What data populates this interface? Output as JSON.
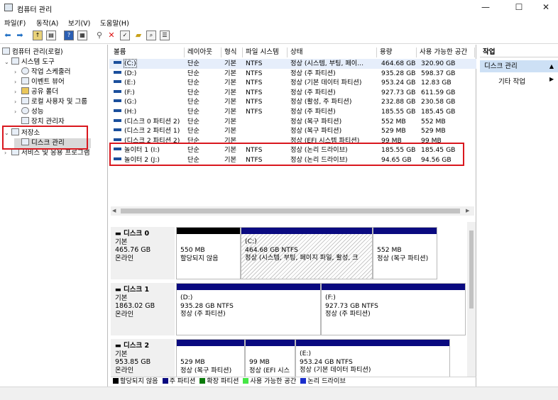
{
  "window": {
    "title": "컴퓨터 관리",
    "minimize": "—",
    "maximize": "☐",
    "close": "✕"
  },
  "menu": [
    "파일(F)",
    "동작(A)",
    "보기(V)",
    "도움말(H)"
  ],
  "tree": {
    "root": "컴퓨터 관리(로컬)",
    "system_tools": "시스템 도구",
    "task_scheduler": "작업 스케줄러",
    "event_viewer": "이벤트 뷰어",
    "shared_folders": "공유 폴더",
    "local_users": "로컬 사용자 및 그룹",
    "performance": "성능",
    "device_manager": "장치 관리자",
    "storage": "저장소",
    "disk_management": "디스크 관리",
    "services": "서비스 및 응용 프로그램"
  },
  "table": {
    "headers": [
      "볼륨",
      "레이아웃",
      "형식",
      "파일 시스템",
      "상태",
      "용량",
      "사용 가능한 공간"
    ],
    "rows": [
      [
        "(C:)",
        "단순",
        "기본",
        "NTFS",
        "정상 (시스템, 부팅, 페이...",
        "464.68 GB",
        "320.90 GB"
      ],
      [
        "(D:)",
        "단순",
        "기본",
        "NTFS",
        "정상 (주 파티션)",
        "935.28 GB",
        "598.37 GB"
      ],
      [
        "(E:)",
        "단순",
        "기본",
        "NTFS",
        "정상 (기본 데이터 파티션)",
        "953.24 GB",
        "12.83 GB"
      ],
      [
        "(F:)",
        "단순",
        "기본",
        "NTFS",
        "정상 (주 파티션)",
        "927.73 GB",
        "611.59 GB"
      ],
      [
        "(G:)",
        "단순",
        "기본",
        "NTFS",
        "정상 (활성, 주 파티션)",
        "232.88 GB",
        "230.58 GB"
      ],
      [
        "(H:)",
        "단순",
        "기본",
        "NTFS",
        "정상 (주 파티션)",
        "185.55 GB",
        "185.45 GB"
      ],
      [
        "(디스크 0 파티션 2)",
        "단순",
        "기본",
        "",
        "정상 (복구 파티션)",
        "552 MB",
        "552 MB"
      ],
      [
        "(디스크 2 파티션 1)",
        "단순",
        "기본",
        "",
        "정상 (복구 파티션)",
        "529 MB",
        "529 MB"
      ],
      [
        "(디스크 2 파티션 2)",
        "단순",
        "기본",
        "",
        "정상 (EFI 시스템 파티션)",
        "99 MB",
        "99 MB"
      ],
      [
        "놀이터 1 (I:)",
        "단순",
        "기본",
        "NTFS",
        "정상 (논리 드라이브)",
        "185.55 GB",
        "185.45 GB"
      ],
      [
        "놀이터 2 (J:)",
        "단순",
        "기본",
        "NTFS",
        "정상 (논리 드라이브)",
        "94.65 GB",
        "94.56 GB"
      ]
    ]
  },
  "disks": [
    {
      "name": "디스크 0",
      "type": "기본",
      "size": "465.76 GB",
      "status": "온라인",
      "partitions": [
        {
          "label": "",
          "size": "550 MB",
          "status": "할당되지 않음"
        },
        {
          "label": "(C:)",
          "size": "464.68 GB NTFS",
          "status": "정상 (시스템, 부팅, 페이지 파일, 활성, 크"
        },
        {
          "label": "",
          "size": "552 MB",
          "status": "정상 (복구 파티션)"
        }
      ]
    },
    {
      "name": "디스크 1",
      "type": "기본",
      "size": "1863.02 GB",
      "status": "온라인",
      "partitions": [
        {
          "label": "(D:)",
          "size": "935.28 GB NTFS",
          "status": "정상 (주 파티션)"
        },
        {
          "label": "(F:)",
          "size": "927.73 GB NTFS",
          "status": "정상 (주 파티션)"
        }
      ]
    },
    {
      "name": "디스크 2",
      "type": "기본",
      "size": "953.85 GB",
      "status": "온라인",
      "partitions": [
        {
          "label": "",
          "size": "529 MB",
          "status": "정상 (복구 파티션)"
        },
        {
          "label": "",
          "size": "99 MB",
          "status": "정상 (EFI 시스"
        },
        {
          "label": "(E:)",
          "size": "953.24 GB NTFS",
          "status": "정상 (기본 데이터 파티션)"
        }
      ]
    }
  ],
  "legend": [
    {
      "label": "할당되지 않음",
      "color": "#000000"
    },
    {
      "label": "주 파티션",
      "color": "#0a0a80"
    },
    {
      "label": "확장 파티션",
      "color": "#0b7a0b"
    },
    {
      "label": "사용 가능한 공간",
      "color": "#46e646"
    },
    {
      "label": "논리 드라이브",
      "color": "#1a2ecc"
    }
  ],
  "actions": {
    "header": "작업",
    "selected": "디스크 관리",
    "more": "기타 작업"
  }
}
